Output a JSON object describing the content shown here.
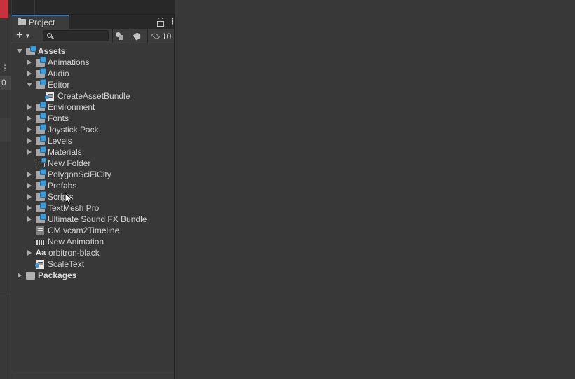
{
  "project_panel": {
    "tab_label": "Project",
    "add_label": "+",
    "search": {
      "value": "",
      "placeholder": ""
    },
    "hidden_count": "10"
  },
  "left_strip": {
    "value": "0"
  },
  "tree": [
    {
      "label": "Assets",
      "depth": 0,
      "arrow": "down",
      "icon": "folder-asset-icon",
      "bold": true
    },
    {
      "label": "Animations",
      "depth": 1,
      "arrow": "right",
      "icon": "folder-asset-icon"
    },
    {
      "label": "Audio",
      "depth": 1,
      "arrow": "right",
      "icon": "folder-asset-icon"
    },
    {
      "label": "Editor",
      "depth": 1,
      "arrow": "down",
      "icon": "folder-asset-icon"
    },
    {
      "label": "CreateAssetBundle",
      "depth": 2,
      "arrow": "none",
      "icon": "script-icon"
    },
    {
      "label": "Environment",
      "depth": 1,
      "arrow": "right",
      "icon": "folder-asset-icon"
    },
    {
      "label": "Fonts",
      "depth": 1,
      "arrow": "right",
      "icon": "folder-asset-icon"
    },
    {
      "label": "Joystick Pack",
      "depth": 1,
      "arrow": "right",
      "icon": "folder-asset-icon"
    },
    {
      "label": "Levels",
      "depth": 1,
      "arrow": "right",
      "icon": "folder-asset-icon"
    },
    {
      "label": "Materials",
      "depth": 1,
      "arrow": "right",
      "icon": "folder-asset-icon"
    },
    {
      "label": "New Folder",
      "depth": 1,
      "arrow": "none",
      "icon": "empty-folder-icon"
    },
    {
      "label": "PolygonSciFiCity",
      "depth": 1,
      "arrow": "right",
      "icon": "folder-asset-icon"
    },
    {
      "label": "Prefabs",
      "depth": 1,
      "arrow": "right",
      "icon": "folder-asset-icon"
    },
    {
      "label": "Scripts",
      "depth": 1,
      "arrow": "right",
      "icon": "folder-asset-icon"
    },
    {
      "label": "TextMesh Pro",
      "depth": 1,
      "arrow": "right",
      "icon": "folder-asset-icon"
    },
    {
      "label": "Ultimate Sound FX Bundle",
      "depth": 1,
      "arrow": "right",
      "icon": "folder-asset-icon"
    },
    {
      "label": "CM vcam2Timeline",
      "depth": 1,
      "arrow": "none",
      "icon": "timeline-icon"
    },
    {
      "label": "New Animation",
      "depth": 1,
      "arrow": "none",
      "icon": "animation-clip-icon"
    },
    {
      "label": "orbitron-black",
      "depth": 1,
      "arrow": "right",
      "icon": "font-icon"
    },
    {
      "label": "ScaleText",
      "depth": 1,
      "arrow": "none",
      "icon": "script-icon"
    },
    {
      "label": "Packages",
      "depth": 0,
      "arrow": "right",
      "icon": "folder-icon",
      "bold": true
    }
  ]
}
